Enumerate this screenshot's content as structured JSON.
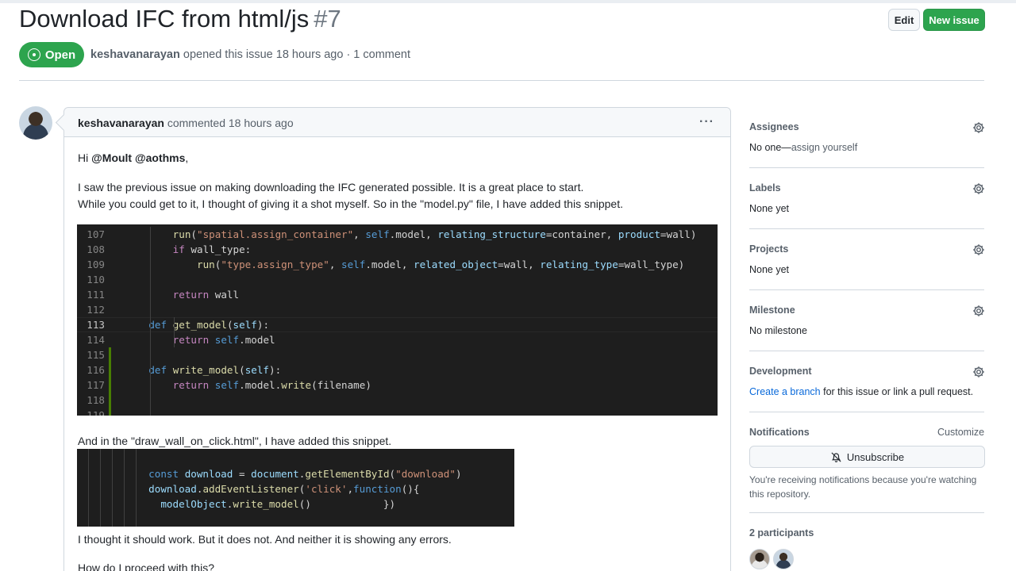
{
  "issue": {
    "title": "Download IFC from html/js",
    "number": "#7",
    "state": "Open",
    "author": "keshavanarayan",
    "meta_rest": " opened this issue 18 hours ago · 1 comment"
  },
  "header_buttons": {
    "edit": "Edit",
    "new_issue": "New issue"
  },
  "comment": {
    "author": "keshavanarayan",
    "action": " commented 18 hours ago",
    "menu": "···",
    "greeting_prefix": "Hi ",
    "mentions": "@Moult @aothms",
    "greeting_suffix": ",",
    "para1_line1": "I saw the previous issue on making downloading the IFC generated possible. It is a great place to start.",
    "para1_line2": "While you could get to it, I thought of giving it a shot myself. So in the \"model.py\" file, I have added this snippet.",
    "para2": "And in the \"draw_wall_on_click.html\", I have added this snippet.",
    "para3": "I thought it should work. But it does not. And neither it is showing any errors.",
    "para4": "How do I proceed with this?"
  },
  "code_snippet_1": {
    "lines": [
      {
        "n": "107",
        "parts": [
          [
            "t",
            "        "
          ],
          [
            "f",
            "run"
          ],
          [
            "t",
            "("
          ],
          [
            "s",
            "\"spatial.assign_container\""
          ],
          [
            "t",
            ", "
          ],
          [
            "k",
            "self"
          ],
          [
            "t",
            ".model, "
          ],
          [
            "v",
            "relating_structure"
          ],
          [
            "t",
            "=container, "
          ],
          [
            "v",
            "product"
          ],
          [
            "t",
            "=wall)"
          ]
        ]
      },
      {
        "n": "108",
        "parts": [
          [
            "t",
            "        "
          ],
          [
            "r",
            "if"
          ],
          [
            "t",
            " wall_type:"
          ]
        ]
      },
      {
        "n": "109",
        "parts": [
          [
            "t",
            "            "
          ],
          [
            "f",
            "run"
          ],
          [
            "t",
            "("
          ],
          [
            "s",
            "\"type.assign_type\""
          ],
          [
            "t",
            ", "
          ],
          [
            "k",
            "self"
          ],
          [
            "t",
            ".model, "
          ],
          [
            "v",
            "related_object"
          ],
          [
            "t",
            "=wall, "
          ],
          [
            "v",
            "relating_type"
          ],
          [
            "t",
            "=wall_type)"
          ]
        ]
      },
      {
        "n": "110",
        "parts": []
      },
      {
        "n": "111",
        "parts": [
          [
            "t",
            "        "
          ],
          [
            "r",
            "return"
          ],
          [
            "t",
            " wall"
          ]
        ]
      },
      {
        "n": "112",
        "parts": []
      },
      {
        "n": "113",
        "parts": [
          [
            "t",
            "    "
          ],
          [
            "k",
            "def"
          ],
          [
            "t",
            " "
          ],
          [
            "f",
            "get_model"
          ],
          [
            "t",
            "("
          ],
          [
            "v",
            "self"
          ],
          [
            "t",
            "):"
          ]
        ]
      },
      {
        "n": "114",
        "parts": [
          [
            "t",
            "        "
          ],
          [
            "r",
            "return"
          ],
          [
            "t",
            " "
          ],
          [
            "k",
            "self"
          ],
          [
            "t",
            ".model"
          ]
        ]
      },
      {
        "n": "115",
        "parts": []
      },
      {
        "n": "116",
        "parts": [
          [
            "t",
            "    "
          ],
          [
            "k",
            "def"
          ],
          [
            "t",
            " "
          ],
          [
            "f",
            "write_model"
          ],
          [
            "t",
            "("
          ],
          [
            "v",
            "self"
          ],
          [
            "t",
            "):"
          ]
        ]
      },
      {
        "n": "117",
        "parts": [
          [
            "t",
            "        "
          ],
          [
            "r",
            "return"
          ],
          [
            "t",
            " "
          ],
          [
            "k",
            "self"
          ],
          [
            "t",
            ".model."
          ],
          [
            "f",
            "write"
          ],
          [
            "t",
            "(filename)"
          ]
        ]
      },
      {
        "n": "118",
        "parts": []
      },
      {
        "n": "119",
        "parts": []
      }
    ]
  },
  "code_snippet_2": {
    "lines": [
      {
        "parts": [
          [
            "t",
            "  "
          ],
          [
            "k",
            "const"
          ],
          [
            "t",
            " "
          ],
          [
            "v",
            "download"
          ],
          [
            "t",
            " = "
          ],
          [
            "v",
            "document"
          ],
          [
            "t",
            "."
          ],
          [
            "f",
            "getElementById"
          ],
          [
            "t",
            "("
          ],
          [
            "s",
            "\"download\""
          ],
          [
            "t",
            ")"
          ]
        ]
      },
      {
        "parts": [
          [
            "t",
            "  "
          ],
          [
            "v",
            "download"
          ],
          [
            "t",
            "."
          ],
          [
            "f",
            "addEventListener"
          ],
          [
            "t",
            "("
          ],
          [
            "s",
            "'click'"
          ],
          [
            "t",
            ","
          ],
          [
            "k",
            "function"
          ],
          [
            "t",
            "(){"
          ]
        ]
      },
      {
        "parts": [
          [
            "t",
            "    "
          ],
          [
            "v",
            "modelObject"
          ],
          [
            "t",
            "."
          ],
          [
            "f",
            "write_model"
          ],
          [
            "t",
            "()            })"
          ]
        ]
      }
    ]
  },
  "sidebar": {
    "assignees": {
      "heading": "Assignees",
      "value_prefix": "No one—",
      "value_link": "assign yourself"
    },
    "labels": {
      "heading": "Labels",
      "value": "None yet"
    },
    "projects": {
      "heading": "Projects",
      "value": "None yet"
    },
    "milestone": {
      "heading": "Milestone",
      "value": "No milestone"
    },
    "development": {
      "heading": "Development",
      "link": "Create a branch",
      "rest": " for this issue or link a pull request."
    },
    "notifications": {
      "heading": "Notifications",
      "customize": "Customize",
      "button": "Unsubscribe",
      "note": "You're receiving notifications because you're watching this repository."
    },
    "participants": {
      "heading": "2 participants"
    }
  },
  "icons": {
    "gear": "gear-icon",
    "bell_slash": "bell-slash-icon",
    "issue_open": "issue-opened-icon",
    "kebab": "kebab-horizontal-icon"
  },
  "colors": {
    "open_green": "#2da44e",
    "link_blue": "#0969da",
    "muted": "#57606a"
  }
}
